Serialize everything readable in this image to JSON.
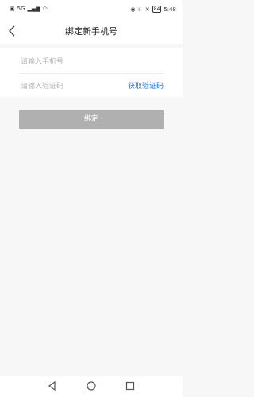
{
  "status_bar": {
    "signal_text": "5G",
    "battery_level": "84",
    "time": "5:48"
  },
  "header": {
    "title": "绑定新手机号"
  },
  "form": {
    "phone_placeholder": "请输入手机号",
    "code_placeholder": "请输入验证码",
    "get_code_label": "获取验证码",
    "submit_label": "绑定"
  },
  "colors": {
    "link_blue": "#1a73e8",
    "button_disabled": "#b0b0b0"
  },
  "icons": {
    "back": "back-arrow-icon",
    "nav_back": "triangle-back-icon",
    "nav_home": "circle-home-icon",
    "nav_recent": "square-recent-icon"
  }
}
